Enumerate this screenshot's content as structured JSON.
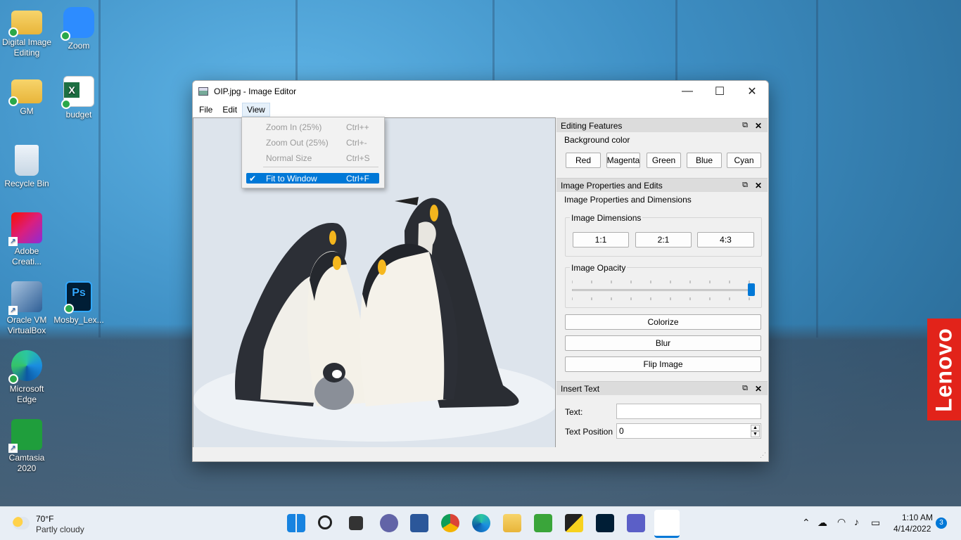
{
  "desktop": {
    "icons": [
      {
        "label": "Digital Image Editing",
        "icon": "folder-icon"
      },
      {
        "label": "Zoom",
        "icon": "zoom-icon"
      },
      {
        "label": "GM",
        "icon": "folder-icon"
      },
      {
        "label": "budget",
        "icon": "excel-icon"
      },
      {
        "label": "Recycle Bin",
        "icon": "recycle-bin-icon"
      },
      {
        "label": "Adobe Creati...",
        "icon": "adobe-cc-icon"
      },
      {
        "label": "Oracle VM VirtualBox",
        "icon": "virtualbox-icon"
      },
      {
        "label": "Mosby_Lex...",
        "icon": "photoshop-file-icon"
      },
      {
        "label": "Microsoft Edge",
        "icon": "edge-icon"
      },
      {
        "label": "Camtasia 2020",
        "icon": "camtasia-icon"
      }
    ],
    "brand": "Lenovo"
  },
  "window": {
    "title": "OIP.jpg - Image Editor",
    "controls": {
      "minimize": "—",
      "maximize": "☐",
      "close": "✕"
    },
    "menu": [
      "File",
      "Edit",
      "View"
    ],
    "view_menu": {
      "items": [
        {
          "label": "Zoom In (25%)",
          "shortcut": "Ctrl++",
          "enabled": false
        },
        {
          "label": "Zoom Out (25%)",
          "shortcut": "Ctrl+-",
          "enabled": false
        },
        {
          "label": "Normal Size",
          "shortcut": "Ctrl+S",
          "enabled": false
        },
        {
          "label": "Fit to Window",
          "shortcut": "Ctrl+F",
          "checked": true
        }
      ]
    }
  },
  "editing_features": {
    "title": "Editing Features",
    "background_label": "Background color",
    "buttons": [
      "Red",
      "Magenta",
      "Green",
      "Blue",
      "Cyan"
    ]
  },
  "image_properties": {
    "title": "Image Properties and Edits",
    "subtitle": "Image Properties and Dimensions",
    "dimensions_label": "Image Dimensions",
    "ratio_buttons": [
      "1:1",
      "2:1",
      "4:3"
    ],
    "opacity_label": "Image Opacity",
    "opacity_value": 1.0,
    "actions": [
      "Colorize",
      "Blur",
      "Flip Image"
    ]
  },
  "insert_text": {
    "title": "Insert Text",
    "text_label": "Text:",
    "text_value": "",
    "position_label": "Text Position",
    "position_value": "0"
  },
  "taskbar": {
    "weather_temp": "70°F",
    "weather_desc": "Partly cloudy",
    "time": "1:10 AM",
    "date": "4/14/2022",
    "notifications": "3"
  }
}
